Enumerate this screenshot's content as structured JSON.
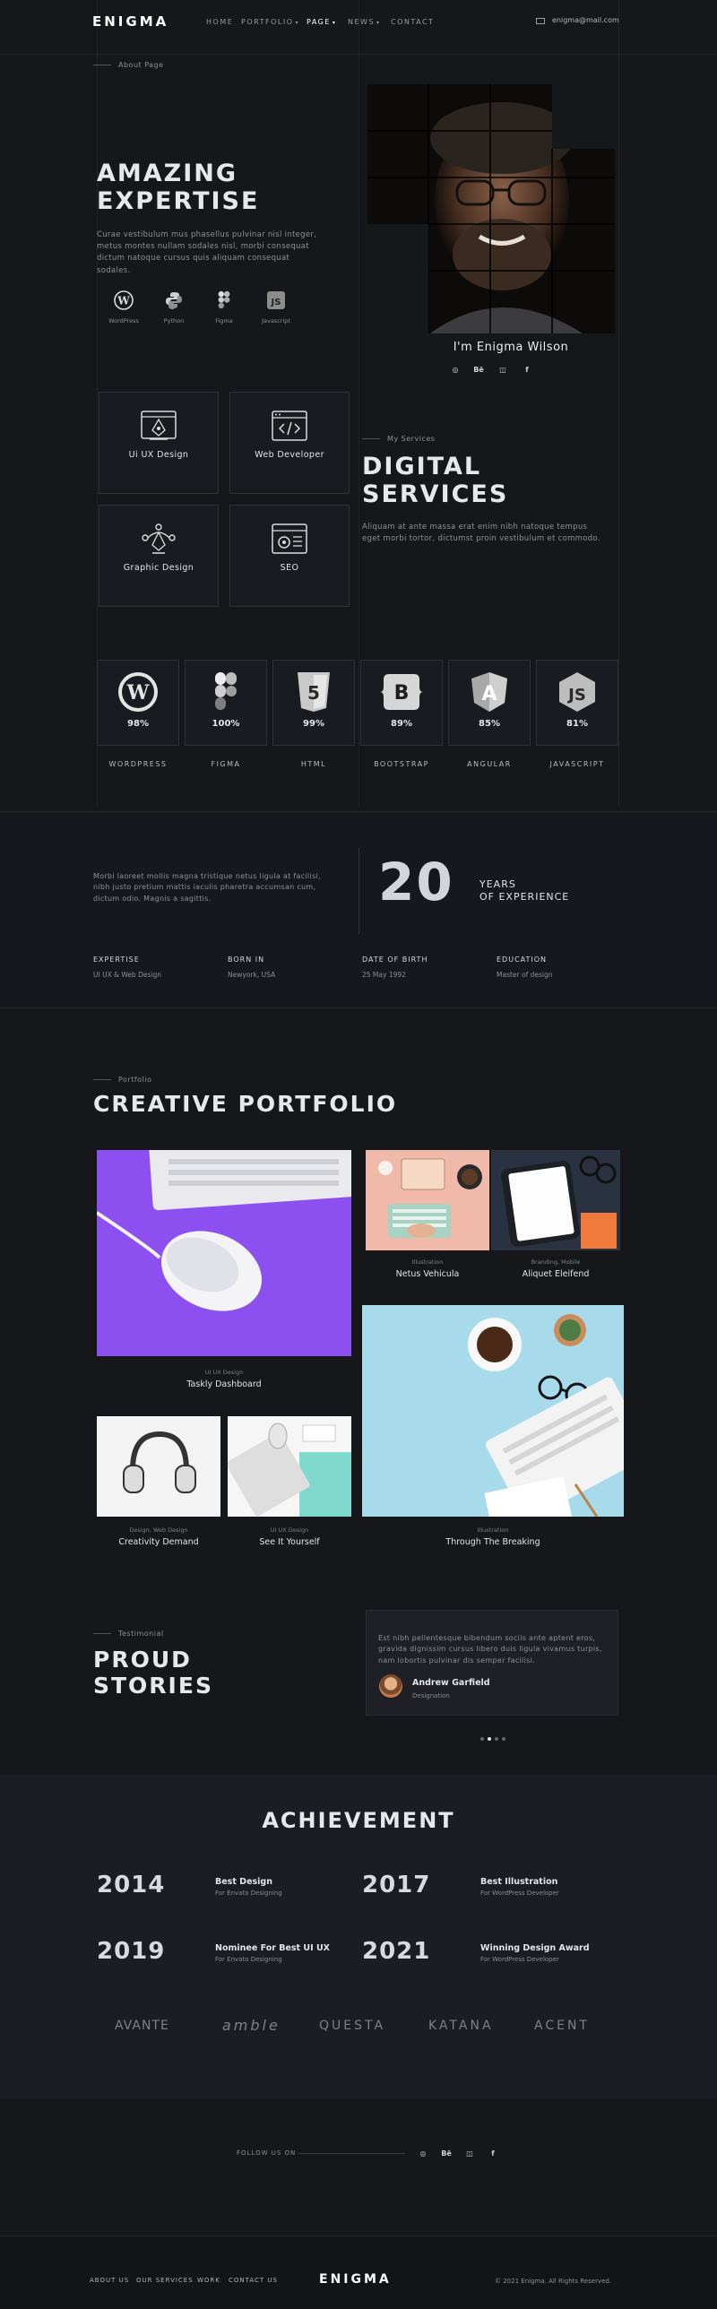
{
  "header": {
    "logo": "ENIGMA",
    "nav": [
      {
        "label": "HOME"
      },
      {
        "label": "PORTFOLIO",
        "caret": "▾"
      },
      {
        "label": "PAGE",
        "caret": "▾"
      },
      {
        "label": "NEWS",
        "caret": "▾"
      },
      {
        "label": "CONTACT"
      }
    ],
    "email_icon": "mail-icon",
    "email": "enigma@mail.com"
  },
  "hero": {
    "eyebrow": "About Page",
    "title_line1": "AMAZING",
    "title_line2": "EXPERTISE",
    "description_line1": "Curae vestibulum mus phasellus pulvinar nisl integer,",
    "description_line2": "metus montes nullam sodales nisl, morbi consequat",
    "description_line3": "dictum  natoque cursus quis aliquam  consequat sodales.",
    "tools": [
      {
        "icon": "wordpress-icon",
        "label": "WordPress"
      },
      {
        "icon": "python-icon",
        "label": "Python"
      },
      {
        "icon": "figma-icon",
        "label": "Figma"
      },
      {
        "icon": "javascript-icon",
        "label": "Javascript"
      }
    ],
    "profile_name": "I'm Enigma Wilson",
    "profile_socials": [
      "dribbble-icon",
      "behance-icon",
      "instagram-icon",
      "facebook-icon"
    ]
  },
  "services": {
    "cards": [
      {
        "icon": "pen-tool-icon",
        "label": "Ui UX Design"
      },
      {
        "icon": "code-window-icon",
        "label": "Web Developer"
      },
      {
        "icon": "vector-path-icon",
        "label": "Graphic Design"
      },
      {
        "icon": "seo-gear-icon",
        "label": "SEO"
      }
    ],
    "eyebrow": "My Services",
    "title_line1": "DIGITAL",
    "title_line2": "SERVICES",
    "description_line1": "Aliquam at ante massa erat enim nibh natoque tempus",
    "description_line2": "eget morbi tortor, dictumst proin vestibulum et commodo."
  },
  "skills": [
    {
      "icon": "wordpress-icon",
      "percent": "98%",
      "name": "WORDPRESS",
      "value": 98
    },
    {
      "icon": "figma-icon",
      "percent": "100%",
      "name": "FIGMA",
      "value": 100
    },
    {
      "icon": "html5-icon",
      "percent": "99%",
      "name": "HTML",
      "value": 99
    },
    {
      "icon": "bootstrap-icon",
      "percent": "89%",
      "name": "BOOTSTRAP",
      "value": 89
    },
    {
      "icon": "angular-icon",
      "percent": "85%",
      "name": "ANGULAR",
      "value": 85
    },
    {
      "icon": "javascript-icon",
      "percent": "81%",
      "name": "JAVASCRIPT",
      "value": 81
    }
  ],
  "experience": {
    "text_line1": "Morbi laoreet mollis magna tristique netus ligula at facilisi,",
    "text_line2": "nibh justo pretium mattis iaculis pharetra accumsan cum,",
    "text_line3": "dictum odio. Magnis a sagittis.",
    "years": "20",
    "years_label_line1": "YEARS",
    "years_label_line2": "OF EXPERIENCE",
    "facts": [
      {
        "heading": "EXPERTISE",
        "value": "UI UX & Web Design"
      },
      {
        "heading": "BORN IN",
        "value": "Newyork, USA"
      },
      {
        "heading": "DATE OF BIRTH",
        "value": "25 May 1992"
      },
      {
        "heading": "EDUCATION",
        "value": "Master of design"
      }
    ]
  },
  "portfolio": {
    "eyebrow": "Portfolio",
    "title": "CREATIVE PORTFOLIO",
    "items": [
      {
        "category": "UI UX Design",
        "name": "Taskly Dashboard"
      },
      {
        "category": "Illustration",
        "name": "Netus Vehicula"
      },
      {
        "category": "Branding, Mobile",
        "name": "Aliquet Eleifend"
      },
      {
        "category": "Design, Web Design",
        "name": "Creativity Demand"
      },
      {
        "category": "UI UX Design",
        "name": "See It Yourself"
      },
      {
        "category": "Illustration",
        "name": "Through The Breaking"
      }
    ]
  },
  "testimonial": {
    "eyebrow": "Testimonial",
    "title_line1": "PROUD",
    "title_line2": "STORIES",
    "quote_line1": "Est nibh pellentesque bibendum sociis ante aptent eros,",
    "quote_line2": "gravida dignissim cursus libero duis ligula vivamus turpis,",
    "quote_line3": "nam lobortis pulvinar dis semper facilisi.",
    "author": "Andrew Garfield",
    "role": "Designation",
    "active_dot": 2,
    "dot_count": 4
  },
  "achievement": {
    "title": "ACHIEVEMENT",
    "items": [
      {
        "year": "2014",
        "title": "Best Design",
        "sub": "For Envato Designing"
      },
      {
        "year": "2017",
        "title": "Best Illustration",
        "sub": "For WordPress Developer"
      },
      {
        "year": "2019",
        "title": "Nominee For Best UI UX",
        "sub": "For Envato Designing"
      },
      {
        "year": "2021",
        "title": "Winning Design Award",
        "sub": "For WordPress Developer"
      }
    ],
    "brands": [
      "AVANTE",
      "amble",
      "QUESTA",
      "KATANA",
      "ACENT"
    ]
  },
  "follow": {
    "label": "FOLLOW US ON",
    "socials": [
      "dribbble-icon",
      "behance-icon",
      "instagram-icon",
      "facebook-icon"
    ]
  },
  "footer": {
    "links": [
      "ABOUT US",
      "OUR SERVICES",
      "WORK",
      "CONTACT US"
    ],
    "logo": "ENIGMA",
    "copyright": "© 2021 Enigma. All Rights Reserved."
  }
}
